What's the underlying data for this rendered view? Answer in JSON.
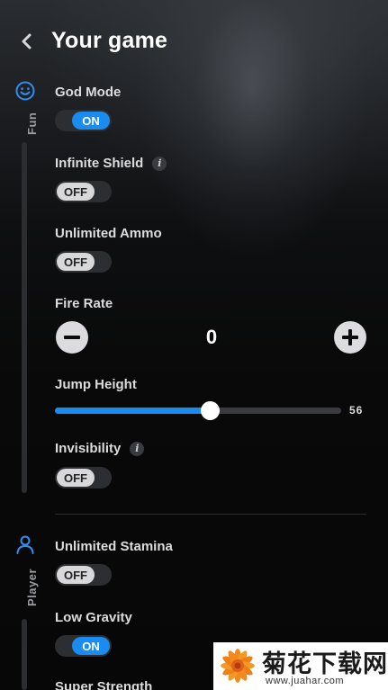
{
  "header": {
    "title": "Your game"
  },
  "rail": {
    "categories": [
      {
        "label": "Fun",
        "icon": "smiley-icon"
      },
      {
        "label": "Player",
        "icon": "person-icon"
      }
    ]
  },
  "options": {
    "god_mode": {
      "label": "God Mode",
      "state": "ON"
    },
    "infinite_shield": {
      "label": "Infinite Shield",
      "state": "OFF",
      "info": "i"
    },
    "unlimited_ammo": {
      "label": "Unlimited Ammo",
      "state": "OFF"
    },
    "fire_rate": {
      "label": "Fire Rate",
      "value": "0"
    },
    "jump_height": {
      "label": "Jump Height",
      "value": "56",
      "fraction": 0.54
    },
    "invisibility": {
      "label": "Invisibility",
      "state": "OFF",
      "info": "i"
    },
    "unlimited_stamina": {
      "label": "Unlimited Stamina",
      "state": "OFF"
    },
    "low_gravity": {
      "label": "Low Gravity",
      "state": "ON"
    },
    "super_strength": {
      "label": "Super Strength"
    }
  },
  "watermark": {
    "text": "菊花下载网",
    "url": "www.juahar.com"
  },
  "colors": {
    "accent": "#1a8cf0",
    "background": "#0a0a0b",
    "toggle_off_knob": "#d8d8da"
  }
}
